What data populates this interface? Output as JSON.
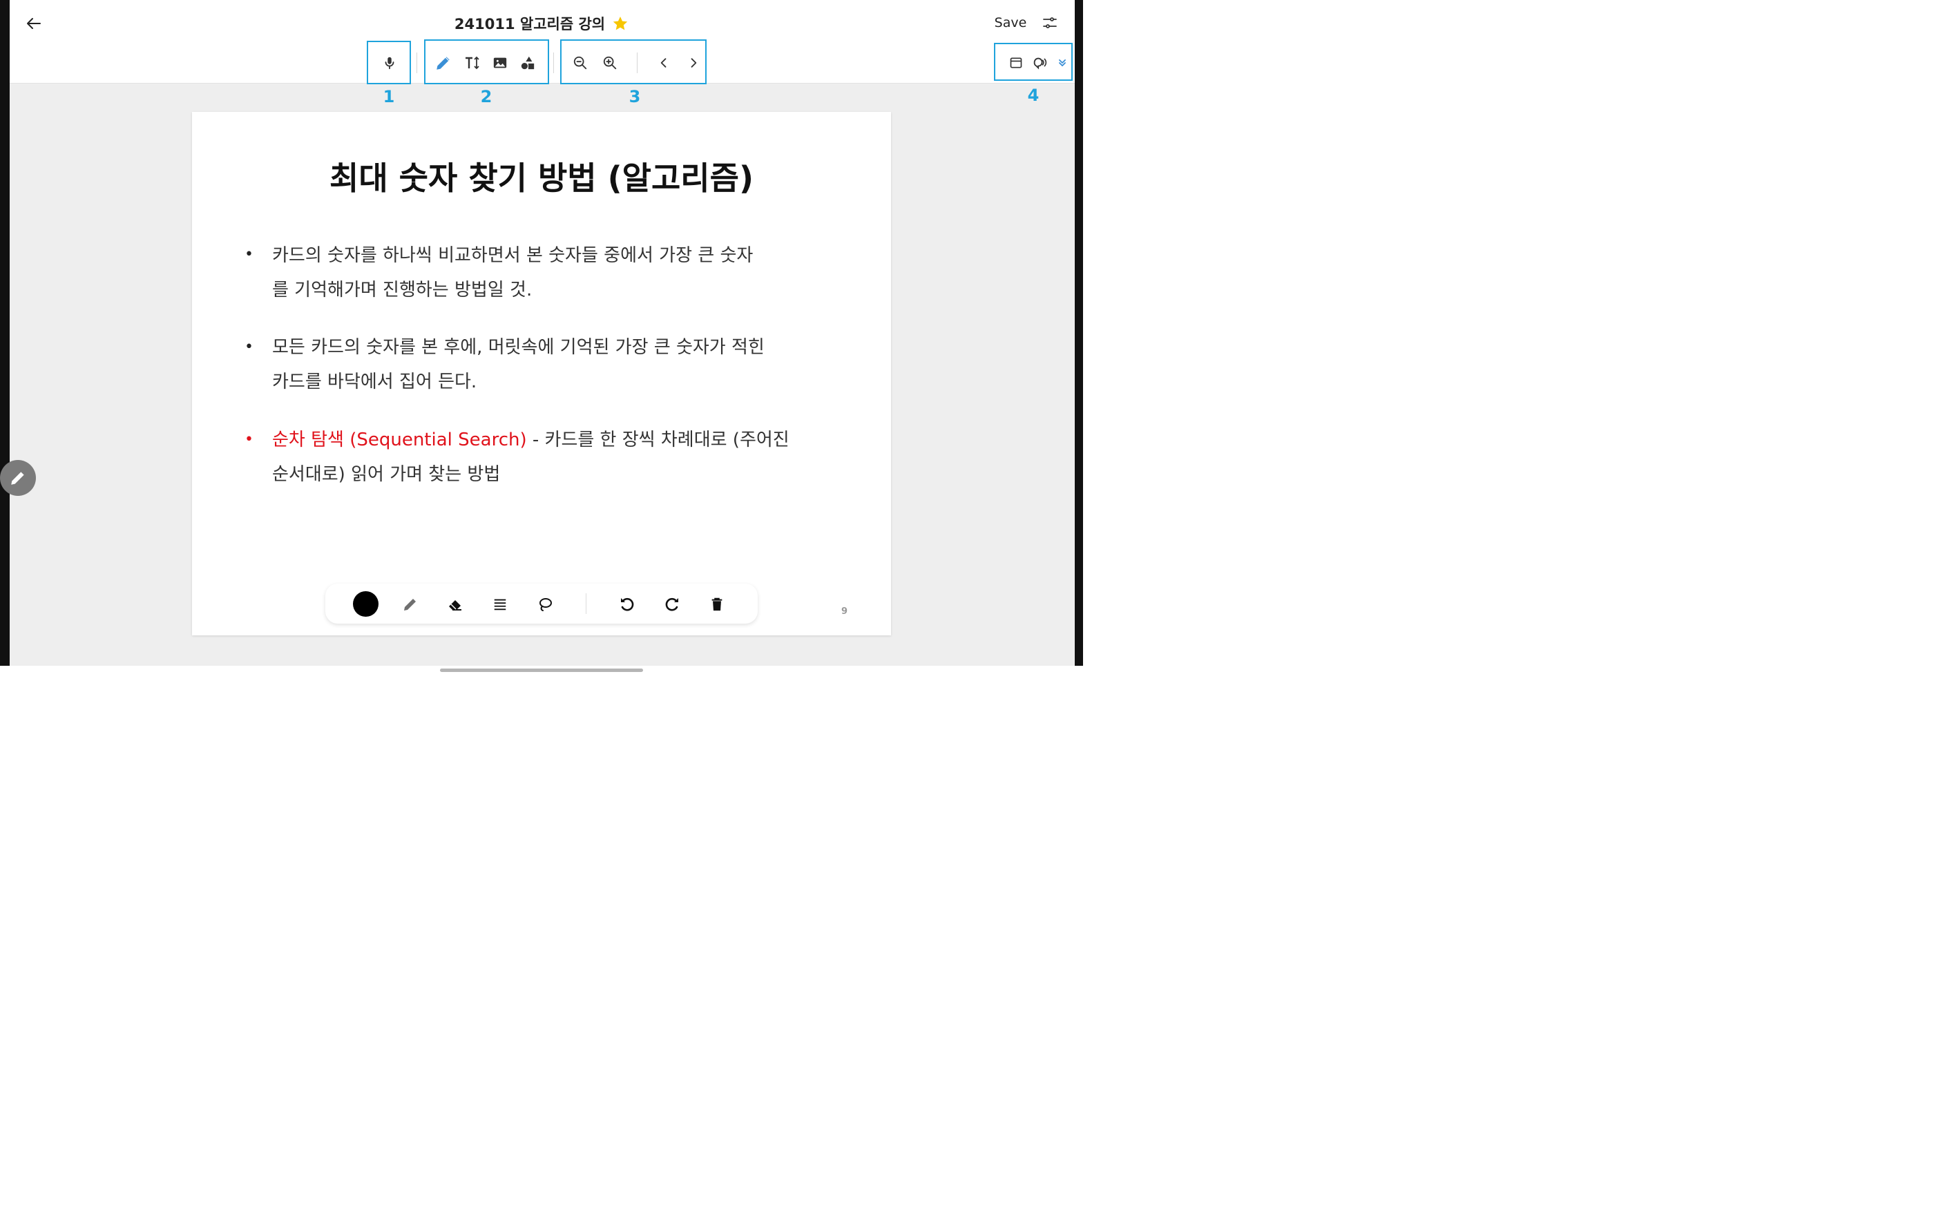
{
  "header": {
    "title": "241011 알고리즘 강의",
    "save_label": "Save",
    "favorite_color": "#F7C600"
  },
  "toolbar": {
    "groups": [
      {
        "label": "1",
        "tools": [
          "mic-icon"
        ]
      },
      {
        "label": "2",
        "tools": [
          "pen-icon",
          "text-size-icon",
          "image-icon",
          "shapes-icon"
        ]
      },
      {
        "label": "3",
        "tools": [
          "zoom-out-icon",
          "zoom-in-icon",
          "chevron-left-icon",
          "chevron-right-icon"
        ]
      },
      {
        "label": "4",
        "tools": [
          "layout-icon",
          "speech-icon",
          "expand-more-icon"
        ]
      }
    ],
    "highlight_color": "#1FA3DC",
    "active_tool_color": "#3A8FD6"
  },
  "slide": {
    "title": "최대 숫자 찾기 방법 (알고리즘)",
    "bullets": [
      {
        "dot": "•",
        "lines": [
          "카드의 숫자를 하나씩 비교하면서 본 숫자들 중에서 가장 큰 숫자",
          "를 기억해가며 진행하는 방법일 것."
        ]
      },
      {
        "dot": "•",
        "lines": [
          "모든 카드의 숫자를 본 후에, 머릿속에 기억된 가장 큰 숫자가 적힌",
          "카드를 바닥에서 집어 든다."
        ]
      },
      {
        "dot": "•",
        "highlight": "순차 탐색 (Sequential Search)",
        "line1_rest": " -  카드를 한 장씩 차례대로 (주어진",
        "line2": "순서대로) 읽어 가며 찾는 방법",
        "highlight_color": "#E0121B"
      }
    ],
    "page_number": "9"
  },
  "pen_toolbar": {
    "tools": [
      "color-swatch",
      "pencil-icon",
      "eraser-icon",
      "line-weight-icon",
      "lasso-icon",
      "undo-icon",
      "redo-icon",
      "trash-icon"
    ],
    "selected_color": "#000000"
  }
}
